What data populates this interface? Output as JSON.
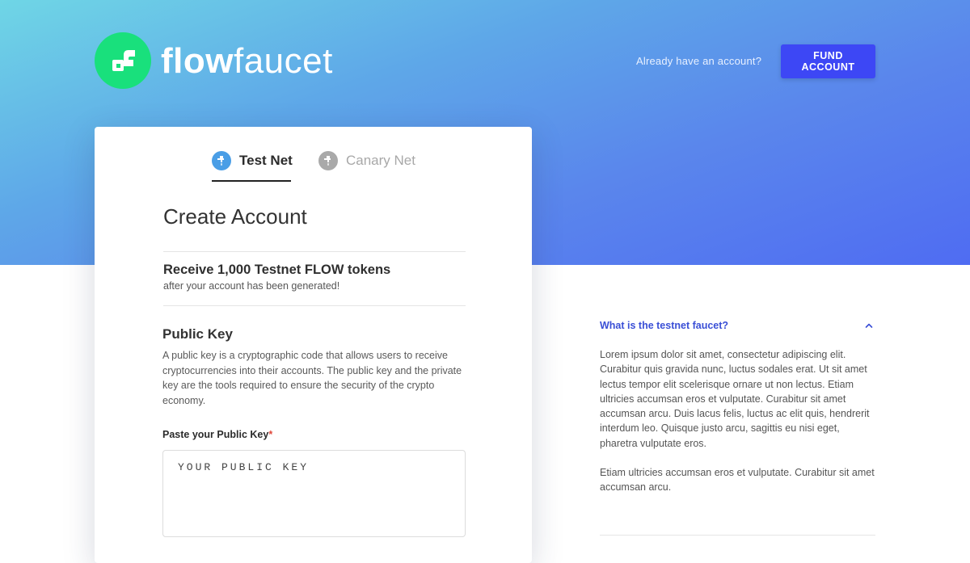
{
  "header": {
    "brand_bold": "flow",
    "brand_light": "faucet",
    "already_text": "Already have an account?",
    "fund_button": "FUND ACCOUNT",
    "logo_icon": "flow-logo-icon"
  },
  "tabs": [
    {
      "label": "Test Net",
      "active": true,
      "icon": "faucet-icon"
    },
    {
      "label": "Canary Net",
      "active": false,
      "icon": "faucet-icon"
    }
  ],
  "card": {
    "title": "Create Account",
    "tokens_title": "Receive 1,000 Testnet FLOW tokens",
    "tokens_sub": "after your account has been generated!",
    "public_key_title": "Public Key",
    "public_key_desc": "A public key is a cryptographic code that allows users to receive cryptocurrencies into their accounts. The public key and the private key are the tools required to ensure the security of the crypto economy.",
    "paste_label": "Paste your Public Key",
    "required_mark": "*",
    "input_placeholder": "YOUR PUBLIC KEY"
  },
  "faq": {
    "question": "What is the testnet faucet?",
    "expanded": true,
    "answer_p1": "Lorem ipsum dolor sit amet, consectetur adipiscing elit. Curabitur quis gravida nunc, luctus sodales erat. Ut sit amet lectus tempor elit scelerisque ornare ut non lectus. Etiam ultricies accumsan eros et vulputate. Curabitur sit amet accumsan arcu. Duis lacus felis, luctus ac elit quis, hendrerit interdum leo. Quisque justo arcu, sagittis eu nisi eget, pharetra vulputate eros.",
    "answer_p2": "Etiam ultricies accumsan eros et vulputate. Curabitur sit amet accumsan arcu."
  },
  "colors": {
    "accent": "#3d47f5",
    "logo_green": "#19e07c",
    "link": "#3a4fd6",
    "required": "#e0473a"
  }
}
